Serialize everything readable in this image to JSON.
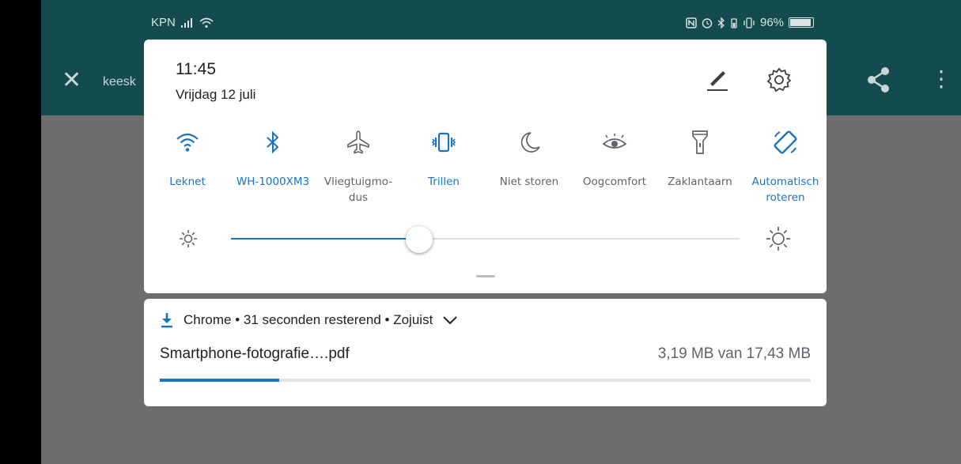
{
  "status_bar": {
    "carrier": "KPN",
    "battery": "96%"
  },
  "app": {
    "title_fragment": "keesk"
  },
  "quick_settings": {
    "time": "11:45",
    "date": "Vrijdag 12 juli",
    "tiles": [
      {
        "label": "Leknet",
        "icon": "wifi-icon",
        "active": true
      },
      {
        "label": "WH-1000XM3",
        "icon": "bluetooth-icon",
        "active": true
      },
      {
        "label": "Vliegtuigmo-\ndus",
        "icon": "airplane-icon",
        "active": false
      },
      {
        "label": "Trillen",
        "icon": "vibrate-icon",
        "active": true
      },
      {
        "label": "Niet storen",
        "icon": "moon-icon",
        "active": false
      },
      {
        "label": "Oogcomfort",
        "icon": "eye-icon",
        "active": false
      },
      {
        "label": "Zaklantaarn",
        "icon": "flashlight-icon",
        "active": false
      },
      {
        "label": "Automatisch\nroteren",
        "icon": "rotate-icon",
        "active": true
      }
    ],
    "brightness_fraction": 0.37
  },
  "notification": {
    "app": "Chrome",
    "time_left": "31 seconden resterend",
    "when": "Zojuist",
    "filename": "Smartphone-fotografie….pdf",
    "size": "3,19 MB van 17,43 MB",
    "progress_fraction": 0.183
  },
  "colors": {
    "accent": "#1a73c1",
    "appbar": "#134b4e",
    "scrim": "#6d6d6d"
  }
}
